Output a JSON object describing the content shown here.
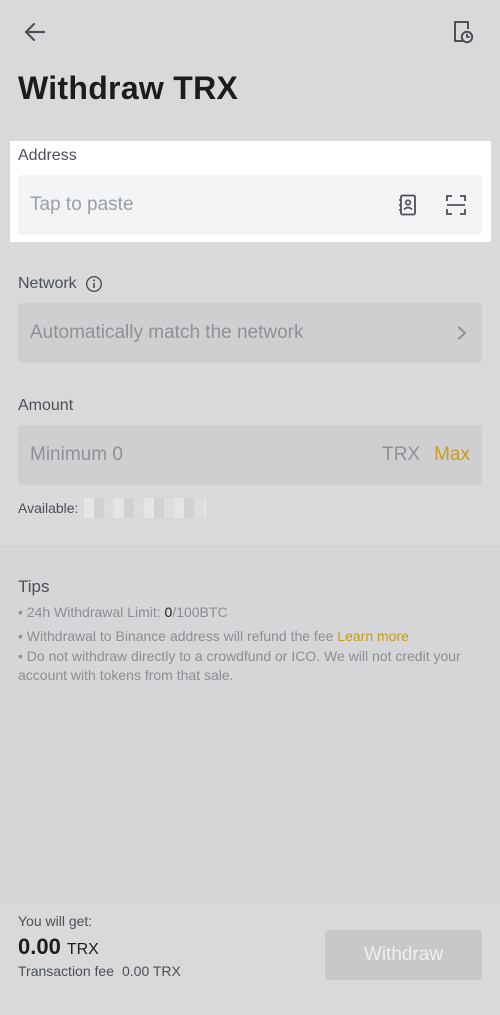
{
  "header": {
    "back_icon": "arrow-left-icon",
    "history_icon": "document-clock-icon",
    "title": "Withdraw TRX"
  },
  "address": {
    "label": "Address",
    "placeholder": "Tap to paste",
    "address_book_icon": "address-book-icon",
    "scan_icon": "scan-icon"
  },
  "network": {
    "label": "Network",
    "info_icon": "info-icon",
    "placeholder": "Automatically match the network",
    "chevron_icon": "chevron-right-icon"
  },
  "amount": {
    "label": "Amount",
    "placeholder": "Minimum 0",
    "unit": "TRX",
    "max_label": "Max",
    "available_label": "Available:"
  },
  "tips": {
    "title": "Tips",
    "limit_prefix": "• 24h Withdrawal Limit: ",
    "limit_used": "0",
    "limit_suffix": "/100BTC",
    "refund_text": "• Withdrawal to Binance address will refund the fee ",
    "learn_more": "Learn more",
    "crowdfund_text": "• Do not withdraw directly to a crowdfund or ICO. We will not credit your account with tokens from that sale."
  },
  "footer": {
    "get_label": "You will get:",
    "amount_value": "0.00",
    "amount_unit": "TRX",
    "fee_label": "Transaction fee",
    "fee_value": "0.00 TRX",
    "withdraw_label": "Withdraw"
  },
  "colors": {
    "accent": "#c89b1a",
    "background": "#d9d9da"
  }
}
